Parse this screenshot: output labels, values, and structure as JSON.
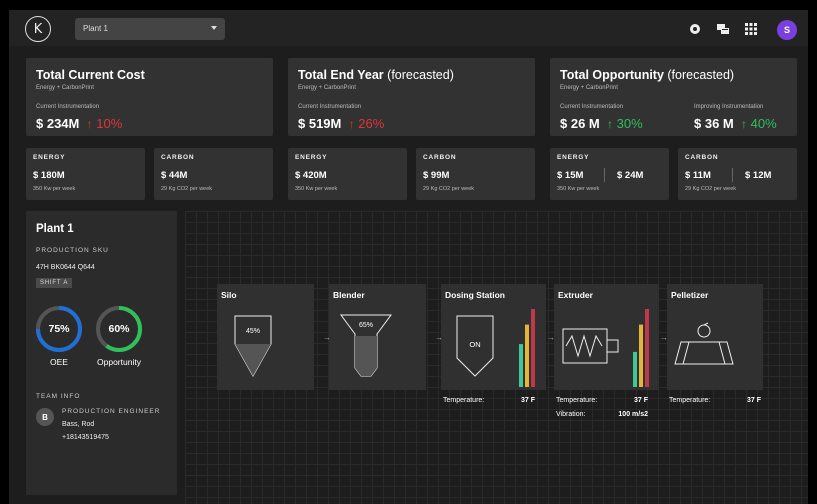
{
  "topbar": {
    "logo_letter": "K",
    "plant_select": "Plant 1",
    "icons": [
      "notification-icon",
      "chat-icon",
      "apps-grid-icon"
    ],
    "user_initial": "S",
    "user_color": "#7b3fe0"
  },
  "colors": {
    "red": "#e03535",
    "green": "#2fbf5b",
    "blue": "#1f6fd6",
    "bar_yellow": "#e3b53b",
    "bar_teal": "#3fc79b",
    "bar_red": "#c0394a"
  },
  "summary": [
    {
      "title": "Total Current Cost",
      "title_light": "",
      "sub": "Energy + CarbonPrint",
      "items": [
        {
          "label": "Current Instrumentation",
          "value": "$ 234M",
          "delta": "10%",
          "dir": "up",
          "color": "red"
        }
      ]
    },
    {
      "title": "Total End Year",
      "title_light": " (forecasted)",
      "sub": "Energy + CarbonPrint",
      "items": [
        {
          "label": "Current Instrumentation",
          "value": "$ 519M",
          "delta": "26%",
          "dir": "up",
          "color": "red"
        }
      ]
    },
    {
      "title": "Total Opportunity",
      "title_light": " (forecasted)",
      "sub": "Energy + CarbonPrint",
      "items": [
        {
          "label": "Current Instrumentation",
          "value": "$ 26 M",
          "delta": "30%",
          "dir": "up",
          "color": "green"
        },
        {
          "label": "Improving Instrumentation",
          "value": "$ 36 M",
          "delta": "40%",
          "dir": "up",
          "color": "green"
        }
      ]
    }
  ],
  "metrics": [
    {
      "head": "ENERGY",
      "value": "$ 180M",
      "value2": "",
      "sub": "350 Kw per week"
    },
    {
      "head": "CARBON",
      "value": "$ 44M",
      "value2": "",
      "sub": "29 Kg CO2 per week"
    },
    {
      "head": "ENERGY",
      "value": "$ 420M",
      "value2": "",
      "sub": "350 Kw per week"
    },
    {
      "head": "CARBON",
      "value": "$ 99M",
      "value2": "",
      "sub": "29 Kg CO2 per week"
    },
    {
      "head": "ENERGY",
      "value": "$ 15M",
      "value2": "$ 24M",
      "sub": "350 Kw per week"
    },
    {
      "head": "CARBON",
      "value": "$ 11M",
      "value2": "$ 12M",
      "sub": "29 Kg CO2 per week"
    }
  ],
  "plant": {
    "name": "Plant 1",
    "sku_label": "PRODUCTION SKU",
    "sku": "47H BK0644 Q644",
    "shift": "SHIFT A",
    "oee": {
      "label": "OEE",
      "value": "75%",
      "fraction": 0.75
    },
    "opportunity": {
      "label": "Opportunity",
      "value": "60%",
      "fraction": 0.6
    },
    "team_label": "TEAM INFO",
    "engineer": {
      "initial": "B",
      "role": "PRODUCTION ENGINEER",
      "name": "Bass, Rod",
      "phone": "+18143519475"
    }
  },
  "process": {
    "stages": [
      {
        "name": "Silo",
        "fill_label": "45%",
        "fill": 0.45
      },
      {
        "name": "Blender",
        "fill_label": "65%",
        "fill": 0.65
      },
      {
        "name": "Dosing Station",
        "state": "ON",
        "bars": [
          0.55,
          0.8,
          1.0
        ],
        "metrics": [
          {
            "label": "Temperature:",
            "value": "37 F"
          }
        ]
      },
      {
        "name": "Extruder",
        "bars": [
          0.45,
          0.8,
          1.0
        ],
        "metrics": [
          {
            "label": "Temperature:",
            "value": "37 F"
          },
          {
            "label": "Vibration:",
            "value": "100 m/s2"
          }
        ]
      },
      {
        "name": "Pelletizer",
        "metrics": [
          {
            "label": "Temperature:",
            "value": "37 F"
          }
        ]
      }
    ],
    "connector": "→"
  }
}
